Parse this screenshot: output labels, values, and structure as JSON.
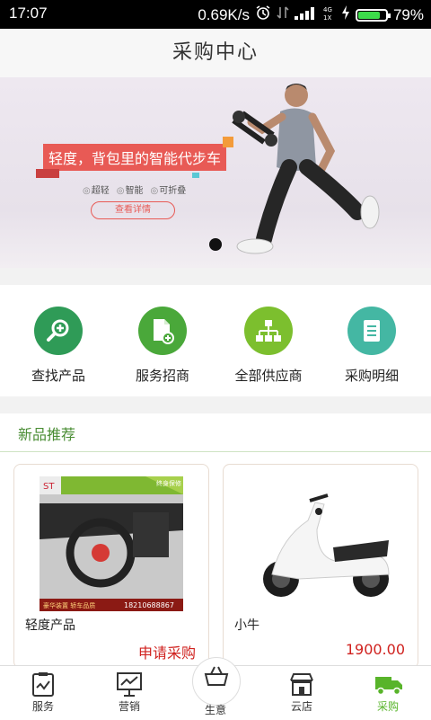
{
  "status_bar": {
    "time": "17:07",
    "speed": "0.69K/s",
    "battery": "79%",
    "battery_level": 0.79
  },
  "header": {
    "title": "采购中心"
  },
  "banner": {
    "headline": "轻度，背包里的智能代步车",
    "features": [
      "超轻",
      "智能",
      "可折叠"
    ],
    "button_label": "查看详情"
  },
  "quick_actions": [
    {
      "label": "查找产品",
      "icon": "search-plus-icon",
      "color": "#2f9b57"
    },
    {
      "label": "服务招商",
      "icon": "document-add-icon",
      "color": "#4aa83a"
    },
    {
      "label": "全部供应商",
      "icon": "org-chart-icon",
      "color": "#7cbf2e"
    },
    {
      "label": "采购明细",
      "icon": "list-document-icon",
      "color": "#44b7a3"
    }
  ],
  "new_products": {
    "title": "新品推荐",
    "items": [
      {
        "name": "轻度产品",
        "price": "申请采购",
        "img_text": {
          "ribbon": "终身保修",
          "phone": "18210688867",
          "caption": "豪华装置  轿车品质"
        }
      },
      {
        "name": "小牛",
        "price": "1900.00"
      }
    ]
  },
  "tabbar": {
    "items": [
      {
        "label": "服务",
        "icon": "clipboard-chart-icon"
      },
      {
        "label": "营销",
        "icon": "presentation-board-icon"
      },
      {
        "label": "生意",
        "icon": "basket-icon"
      },
      {
        "label": "云店",
        "icon": "storefront-icon"
      },
      {
        "label": "采购",
        "icon": "delivery-truck-icon",
        "active": true
      }
    ],
    "accent": "#58b42a"
  }
}
